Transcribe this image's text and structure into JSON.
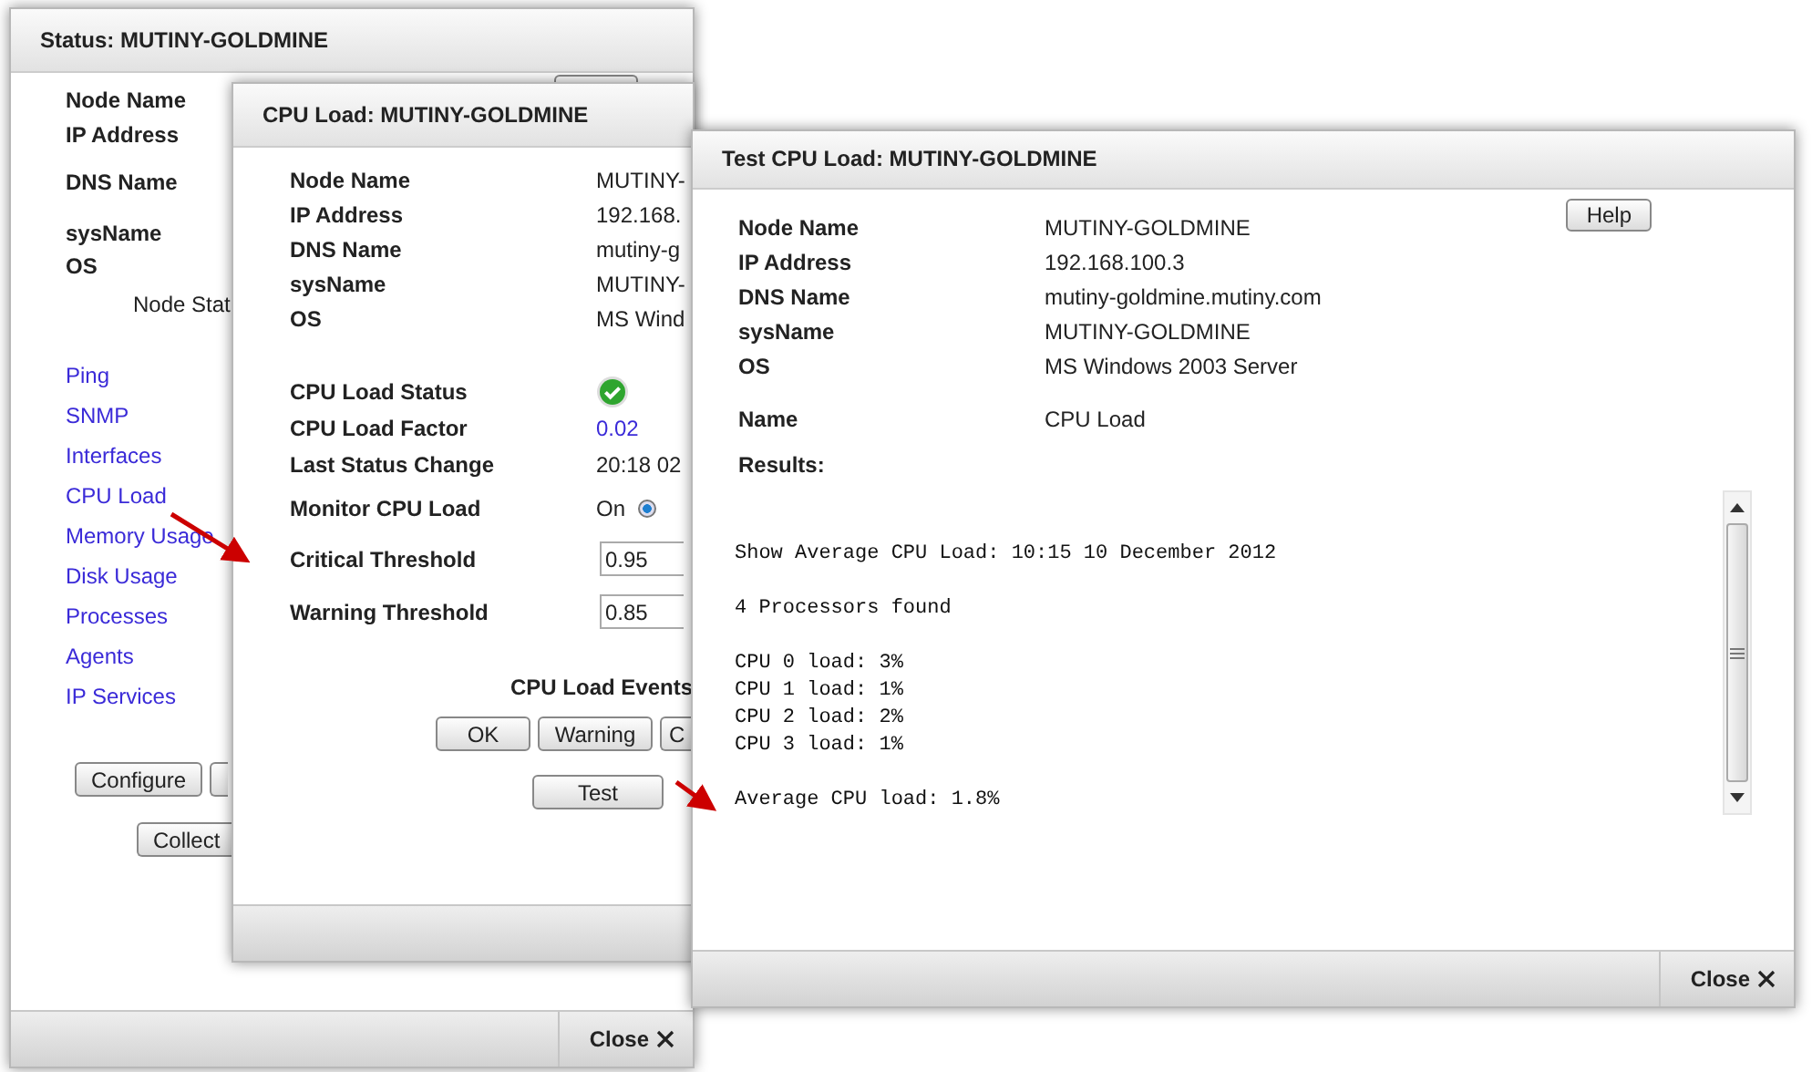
{
  "status_window": {
    "title": "Status: MUTINY-GOLDMINE",
    "fields": [
      "Node Name",
      "IP Address",
      "DNS Name",
      "sysName",
      "OS"
    ],
    "node_status_label": "Node Stat",
    "links": [
      "Ping",
      "SNMP",
      "Interfaces",
      "CPU Load",
      "Memory Usage",
      "Disk Usage",
      "Processes",
      "Agents",
      "IP Services"
    ],
    "configure_button": "Configure",
    "collect_button": "Collect",
    "close_button": "Close"
  },
  "cpu_load_window": {
    "title": "CPU Load: MUTINY-GOLDMINE",
    "node_fields": [
      {
        "label": "Node Name",
        "value": "MUTINY-"
      },
      {
        "label": "IP Address",
        "value": "192.168."
      },
      {
        "label": "DNS Name",
        "value": "mutiny-g"
      },
      {
        "label": "sysName",
        "value": "MUTINY-"
      },
      {
        "label": "OS",
        "value": "MS Wind"
      }
    ],
    "status_fields": [
      {
        "kind": "status",
        "label": "CPU Load Status"
      },
      {
        "kind": "link",
        "label": "CPU Load Factor",
        "value": "0.02"
      },
      {
        "kind": "text",
        "label": "Last Status Change",
        "value": "20:18 02"
      },
      {
        "kind": "radio",
        "label": "Monitor CPU Load",
        "options": [
          {
            "label": "On",
            "selected": true
          }
        ]
      },
      {
        "kind": "input",
        "label": "Critical Threshold",
        "value": "0.95"
      },
      {
        "kind": "input",
        "label": "Warning Threshold",
        "value": "0.85"
      }
    ],
    "events_label": "CPU Load Events",
    "event_buttons": [
      "OK",
      "Warning",
      "C"
    ],
    "test_button": "Test"
  },
  "test_window": {
    "title": "Test CPU Load: MUTINY-GOLDMINE",
    "help_button": "Help",
    "fields": [
      {
        "label": "Node Name",
        "value": "MUTINY-GOLDMINE"
      },
      {
        "label": "IP Address",
        "value": "192.168.100.3"
      },
      {
        "label": "DNS Name",
        "value": "mutiny-goldmine.mutiny.com"
      },
      {
        "label": "sysName",
        "value": "MUTINY-GOLDMINE"
      },
      {
        "label": "OS",
        "value": "MS Windows 2003 Server"
      },
      {
        "label": "Name",
        "value": "CPU Load"
      }
    ],
    "results_label": "Results:",
    "results": [
      [
        "Show Average CPU Load: 10:15 10 December 2012"
      ],
      [
        "4 Processors found"
      ],
      [
        "CPU 0 load: 3%",
        "CPU 1 load: 1%",
        "CPU 2 load: 2%",
        "CPU 3 load: 1%"
      ],
      [
        "Average CPU load: 1.8%"
      ]
    ],
    "close_button": "Close"
  }
}
